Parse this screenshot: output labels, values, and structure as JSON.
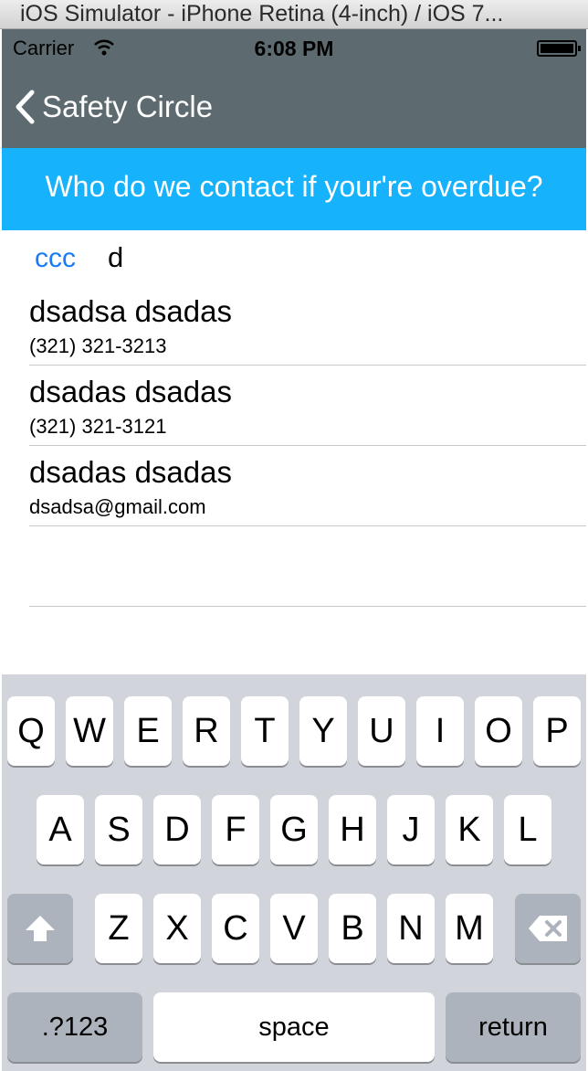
{
  "window_title": "iOS Simulator - iPhone Retina (4-inch) / iOS 7...",
  "status_bar": {
    "carrier": "Carrier",
    "time": "6:08 PM"
  },
  "nav": {
    "back_label": "Safety Circle"
  },
  "banner": {
    "text": "Who do we contact if your're overdue?"
  },
  "search": {
    "token": "ccc",
    "query": "d"
  },
  "contacts": [
    {
      "name": "dsadsa dsadas",
      "detail": "(321) 321-3213"
    },
    {
      "name": "dsadas dsadas",
      "detail": "(321) 321-3121"
    },
    {
      "name": "dsadas dsadas",
      "detail": "dsadsa@gmail.com"
    }
  ],
  "keyboard": {
    "row1": [
      "Q",
      "W",
      "E",
      "R",
      "T",
      "Y",
      "U",
      "I",
      "O",
      "P"
    ],
    "row2": [
      "A",
      "S",
      "D",
      "F",
      "G",
      "H",
      "J",
      "K",
      "L"
    ],
    "row3": [
      "Z",
      "X",
      "C",
      "V",
      "B",
      "N",
      "M"
    ],
    "numbers_label": ".?123",
    "space_label": "space",
    "return_label": "return"
  },
  "colors": {
    "navbar": "#5d6b70",
    "banner": "#16b2fb",
    "token": "#1a7cf5",
    "keyboard": "#d1d5db"
  }
}
